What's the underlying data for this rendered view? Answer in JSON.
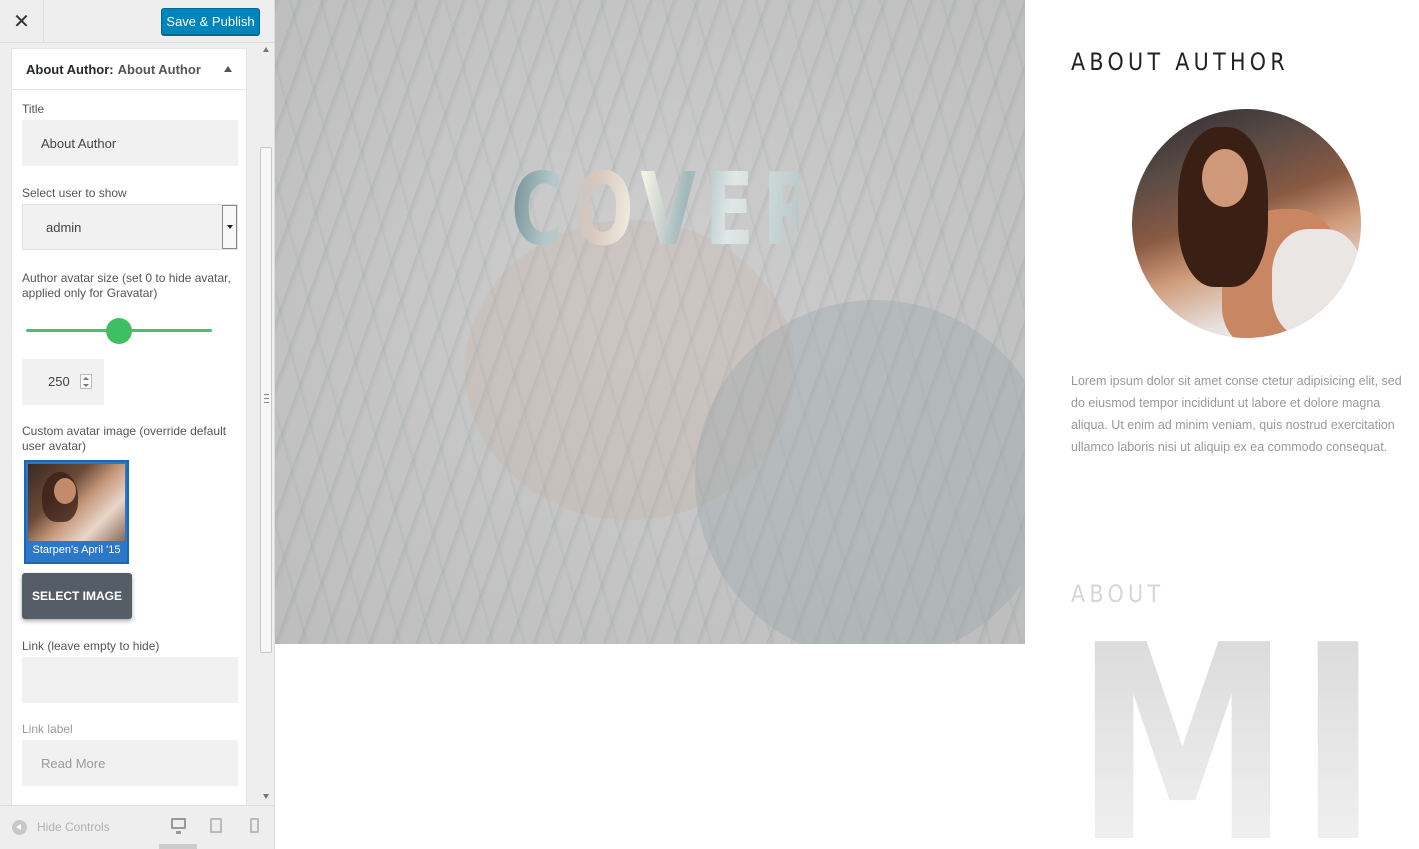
{
  "toolbar": {
    "close_glyph": "✕",
    "publish_label": "Save & Publish"
  },
  "section": {
    "header_prefix": "About Author:",
    "header_name": "About Author"
  },
  "fields": {
    "title_label": "Title",
    "title_value": "About Author",
    "user_label": "Select user to show",
    "user_selected": "admin",
    "avatar_size_label": "Author avatar size (set 0 to hide avatar, applied only for Gravatar)",
    "avatar_size_value": "250",
    "avatar_size_fraction": 0.5,
    "custom_avatar_label": "Custom avatar image (override default user avatar)",
    "custom_avatar_caption": "Starpen's April '15",
    "select_image_label": "SELECT IMAGE",
    "link_label": "Link (leave empty to hide)",
    "link_value": "",
    "link_label_label": "Link label",
    "link_label_placeholder": "Read More"
  },
  "footer": {
    "hide_controls_label": "Hide Controls",
    "active_device": "desktop"
  },
  "preview": {
    "hero_title": "COVERS",
    "widget_title": "ABOUT AUTHOR",
    "bio": "Lorem ipsum dolor sit amet conse ctetur adipisicing elit, sed do eiusmod tempor incididunt ut labore et dolore magna aliqua. Ut enim ad minim veniam, quis nostrud exercitation ullamco laboris nisi ut aliquip ex ea commodo consequat.",
    "about_heading": "ABOUT",
    "big_letters": "MI"
  },
  "colors": {
    "publish_button": "#0085ba",
    "slider": "#3fbf63",
    "select_image_button": "#555d66",
    "thumbnail_selected": "#2a78c7"
  }
}
